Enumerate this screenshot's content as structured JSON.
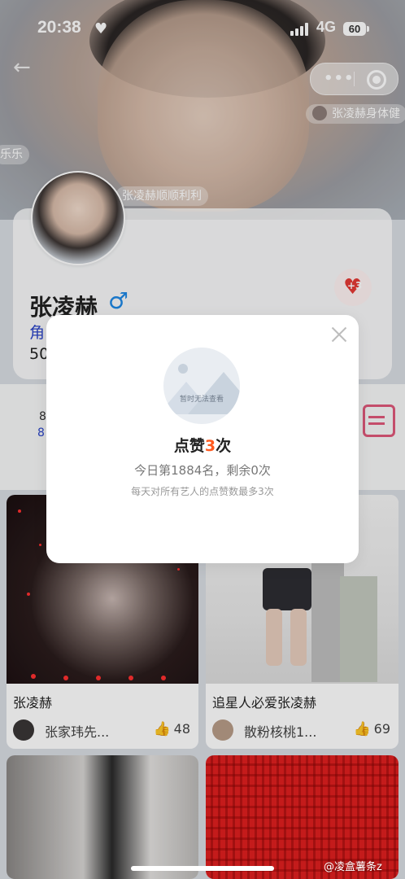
{
  "status_bar": {
    "time": "20:38",
    "network": "4G",
    "battery": "60"
  },
  "danmu": [
    "张凌赫身体健",
    "乐乐",
    "张凌赫顺顺利利"
  ],
  "profile": {
    "name": "张凌赫",
    "gender_symbol": "♂",
    "role_partial": "角",
    "fans_partial": "50",
    "like_badge": "+3"
  },
  "stats": {
    "a": "8",
    "b": "8"
  },
  "modal": {
    "image_caption": "暂时无法查看",
    "title_prefix": "点赞",
    "title_number": "3",
    "title_suffix": "次",
    "rank": "今日第1884名，剩余0次",
    "rule": "每天对所有艺人的点赞数最多3次"
  },
  "posts": [
    {
      "title": "张凌赫",
      "user": "张家玮先...",
      "likes": "48"
    },
    {
      "title": "追星人必爱张凌赫",
      "user": "散粉核桃1...",
      "likes": "69"
    }
  ],
  "watermark": "@凌盒薯条z"
}
